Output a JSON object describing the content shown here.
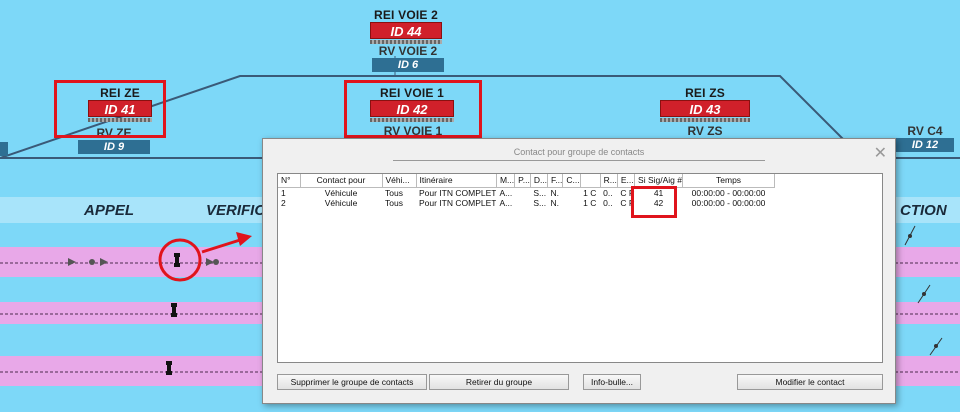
{
  "signals": {
    "rei_voie2": {
      "title": "REI VOIE 2",
      "id": "ID 44"
    },
    "rv_voie2": {
      "title": "RV VOIE 2",
      "id": "ID 6"
    },
    "rei_ze": {
      "title": "REI ZE",
      "id": "ID 41"
    },
    "rv_ze": {
      "title": "RV ZE",
      "id": "ID 9"
    },
    "rei_voie1": {
      "title": "REI VOIE 1",
      "id": "ID 42"
    },
    "rv_voie1": {
      "title": "RV VOIE 1"
    },
    "rei_zs": {
      "title": "REI ZS",
      "id": "ID 43"
    },
    "rv_zs": {
      "title": "RV ZS"
    },
    "rv_c4": {
      "title": "RV C4",
      "id": "ID 12"
    }
  },
  "zones": {
    "appel": "APPEL",
    "verific": "VERIFIC",
    "ction": "CTION"
  },
  "dialog": {
    "title": "Contact pour groupe de contacts",
    "close": "✕",
    "columns": [
      "N°",
      "Contact pour",
      "Véhi...",
      "Itinéraire",
      "M...",
      "P...",
      "D...",
      "F...",
      "C...",
      "",
      "R...",
      "E...",
      "Si Sig/Aig #",
      "Temps"
    ],
    "rows": [
      {
        "n": "1",
        "contact": "Véhicule",
        "vehi": "Tous",
        "itin": "Pour ITN COMPLET",
        "m": "A...",
        "p": "",
        "d": "S...",
        "f": "N.",
        "c": "",
        "x": "1",
        "r": "C",
        "r2": "0..",
        "e": "C",
        "e2": "P",
        "sig": "41",
        "temps": "00:00:00 - 00:00:00"
      },
      {
        "n": "2",
        "contact": "Véhicule",
        "vehi": "Tous",
        "itin": "Pour ITN COMPLET",
        "m": "A...",
        "p": "",
        "d": "S...",
        "f": "N.",
        "c": "",
        "x": "1",
        "r": "C",
        "r2": "0..",
        "e": "C",
        "e2": "P",
        "sig": "42",
        "temps": "00:00:00 - 00:00:00"
      }
    ],
    "buttons": {
      "delete_group": "Supprimer le groupe de contacts",
      "remove_from_group": "Retirer du groupe",
      "tooltip": "Info-bulle...",
      "modify_contact": "Modifier le contact"
    }
  },
  "colors": {
    "background": "#7dd8f8",
    "signal_red": "#d0202a",
    "signal_blue": "#2e6f93",
    "highlight": "#e0141c",
    "band_pink": "#e8a8e8"
  }
}
